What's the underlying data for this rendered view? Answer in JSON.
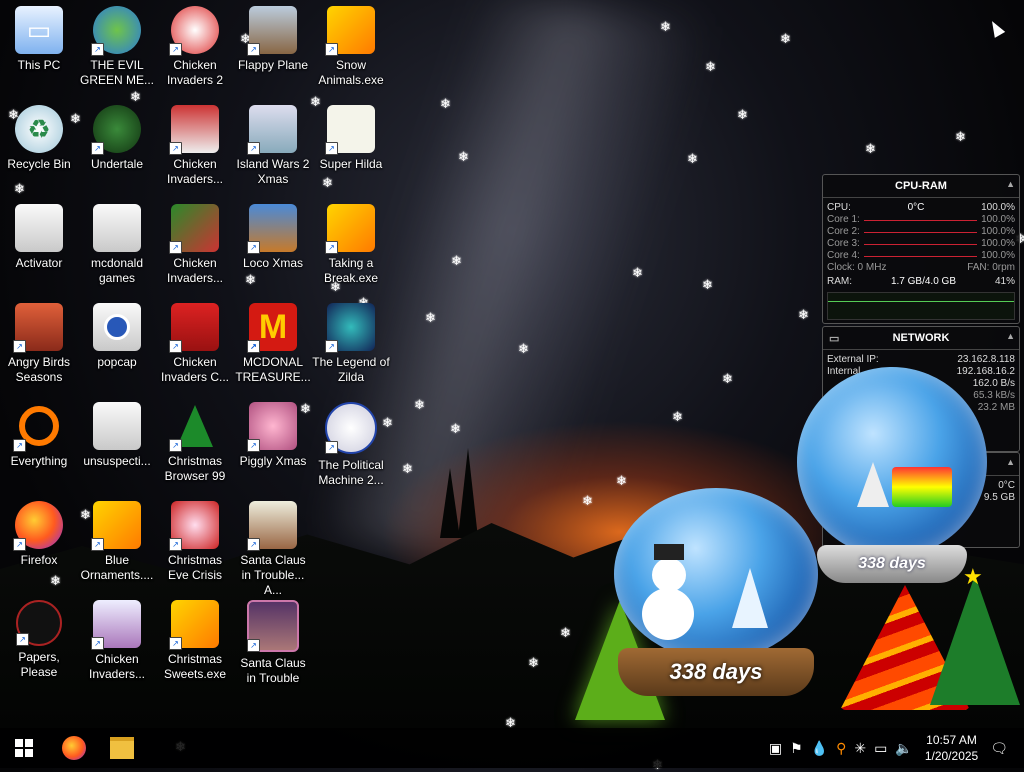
{
  "desktop": {
    "icons": [
      {
        "id": "this-pc",
        "label": "This PC",
        "icon": "monitor-icon"
      },
      {
        "id": "recycle-bin",
        "label": "Recycle Bin",
        "icon": "recycle-bin-icon"
      },
      {
        "id": "activator",
        "label": "Activator",
        "icon": "folder-icon"
      },
      {
        "id": "angry-birds-seasons",
        "label": "Angry Birds Seasons",
        "icon": "angry-birds-icon"
      },
      {
        "id": "everything",
        "label": "Everything",
        "icon": "search-icon"
      },
      {
        "id": "firefox",
        "label": "Firefox",
        "icon": "firefox-icon"
      },
      {
        "id": "papers-please",
        "label": "Papers, Please",
        "icon": "papers-please-icon"
      },
      {
        "id": "the-evil-green-me",
        "label": "THE EVIL GREEN ME...",
        "icon": "messenger-icon"
      },
      {
        "id": "undertale",
        "label": "Undertale",
        "icon": "undertale-icon"
      },
      {
        "id": "mcdonald-games",
        "label": "mcdonald games",
        "icon": "folder-icon"
      },
      {
        "id": "popcap",
        "label": "popcap",
        "icon": "folder-icon"
      },
      {
        "id": "unsuspecti",
        "label": "unsuspecti...",
        "icon": "folder-icon"
      },
      {
        "id": "blue-ornaments",
        "label": "Blue Ornaments....",
        "icon": "gift-icon"
      },
      {
        "id": "chicken-invaders-1",
        "label": "Chicken Invaders...",
        "icon": "chicken-icon"
      },
      {
        "id": "chicken-invaders-2",
        "label": "Chicken Invaders 2",
        "icon": "chicken-icon"
      },
      {
        "id": "chicken-invaders-3",
        "label": "Chicken Invaders...",
        "icon": "chicken-icon"
      },
      {
        "id": "chicken-invaders-4",
        "label": "Chicken Invaders...",
        "icon": "chicken-icon"
      },
      {
        "id": "chicken-invaders-c",
        "label": "Chicken Invaders C...",
        "icon": "chicken-icon"
      },
      {
        "id": "christmas-browser-99",
        "label": "Christmas Browser 99",
        "icon": "christmas-tree-icon"
      },
      {
        "id": "christmas-eve-crisis",
        "label": "Christmas Eve Crisis",
        "icon": "santa-icon"
      },
      {
        "id": "christmas-sweets",
        "label": "Christmas Sweets.exe",
        "icon": "gift-icon"
      },
      {
        "id": "flappy-plane",
        "label": "Flappy Plane",
        "icon": "plane-icon"
      },
      {
        "id": "island-wars-2-xmas",
        "label": "Island Wars 2 Xmas",
        "icon": "island-icon"
      },
      {
        "id": "loco-xmas",
        "label": "Loco Xmas",
        "icon": "teddy-bear-icon"
      },
      {
        "id": "mcdonal-treasure",
        "label": "MCDONAL TREASURE...",
        "icon": "mcdonalds-icon"
      },
      {
        "id": "piggly-xmas",
        "label": "Piggly Xmas",
        "icon": "pig-icon"
      },
      {
        "id": "santa-claus-trouble-a",
        "label": "Santa Claus in Trouble... A...",
        "icon": "santa-icon"
      },
      {
        "id": "santa-claus-trouble",
        "label": "Santa Claus in Trouble",
        "icon": "santa-icon"
      },
      {
        "id": "snow-animals",
        "label": "Snow Animals.exe",
        "icon": "gift-icon"
      },
      {
        "id": "super-hilda",
        "label": "Super Hilda",
        "icon": "hilda-icon"
      },
      {
        "id": "taking-a-break",
        "label": "Taking a Break.exe",
        "icon": "gift-icon"
      },
      {
        "id": "legend-of-zilda",
        "label": "The Legend of Zilda",
        "icon": "zilda-icon"
      },
      {
        "id": "political-machine",
        "label": "The Political Machine 2...",
        "icon": "political-icon"
      }
    ]
  },
  "cpu_ram": {
    "title": "CPU-RAM",
    "cpu_label": "CPU:",
    "cpu_temp": "0°C",
    "cpu_pct": "100.0%",
    "cores": [
      {
        "label": "Core 1:",
        "value": "100.0%"
      },
      {
        "label": "Core 2:",
        "value": "100.0%"
      },
      {
        "label": "Core 3:",
        "value": "100.0%"
      },
      {
        "label": "Core 4:",
        "value": "100.0%"
      }
    ],
    "clock": "Clock: 0 MHz",
    "fan": "FAN: 0rpm",
    "ram_label": "RAM:",
    "ram_value": "1.7 GB/4.0 GB",
    "ram_pct": "41%"
  },
  "network": {
    "title": "NETWORK",
    "external_label": "External IP:",
    "external_ip": "23.162.8.118",
    "internal_label": "Internal",
    "internal_ip": "192.168.16.2",
    "rate1": "162.0 B/s",
    "rate2": "65.3 kB/s",
    "total": "23.2 MB"
  },
  "drive": {
    "temp": "0°C",
    "size": "9.5 GB"
  },
  "globes": {
    "small_days": "338 days",
    "large_days": "338 days"
  },
  "taskbar": {
    "start_icon": "windows-icon",
    "time": "10:57 AM",
    "date": "1/20/2025"
  },
  "colors": {
    "accent": "#0a5bd6",
    "cpu_bar": "#cc2233",
    "tent": "#5cae1a"
  }
}
